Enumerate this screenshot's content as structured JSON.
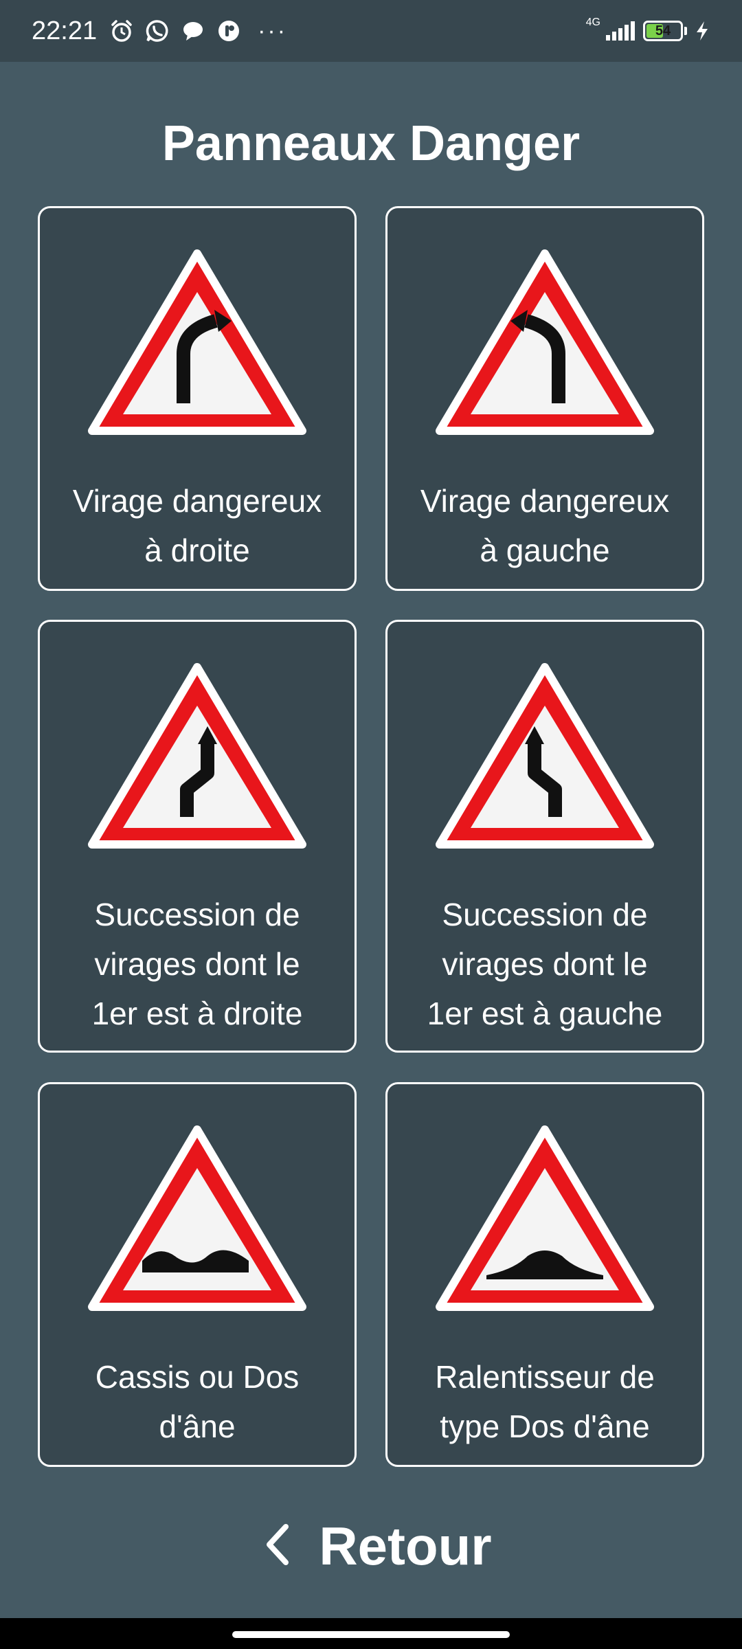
{
  "status_bar": {
    "time": "22:21",
    "network": "4G",
    "battery_level": "54",
    "battery_percent": 54,
    "icons": [
      "alarm-icon",
      "whatsapp-icon",
      "chat-bubble-icon",
      "app-notification-icon",
      "more-dots-icon",
      "signal-icon",
      "battery-icon",
      "charging-icon"
    ],
    "more": "···"
  },
  "page": {
    "title": "Panneaux Danger"
  },
  "signs": [
    {
      "label": "Virage dangereux\nà droite",
      "icon": "curve-right-sign-icon"
    },
    {
      "label": "Virage dangereux\nà gauche",
      "icon": "curve-left-sign-icon"
    },
    {
      "label": "Succession de\nvirages dont le\n1er est à droite",
      "icon": "double-curve-right-sign-icon"
    },
    {
      "label": "Succession de\nvirages dont le\n1er est à gauche",
      "icon": "double-curve-left-sign-icon"
    },
    {
      "label": "Cassis ou Dos\nd'âne",
      "icon": "bumpy-road-sign-icon"
    },
    {
      "label": "Ralentisseur de\ntype Dos d'âne",
      "icon": "speed-bump-sign-icon"
    }
  ],
  "footer": {
    "back_label": "Retour",
    "back_icon": "chevron-left-icon"
  },
  "colors": {
    "background": "#455a64",
    "card": "#37474f",
    "sign_red": "#e8161b"
  }
}
